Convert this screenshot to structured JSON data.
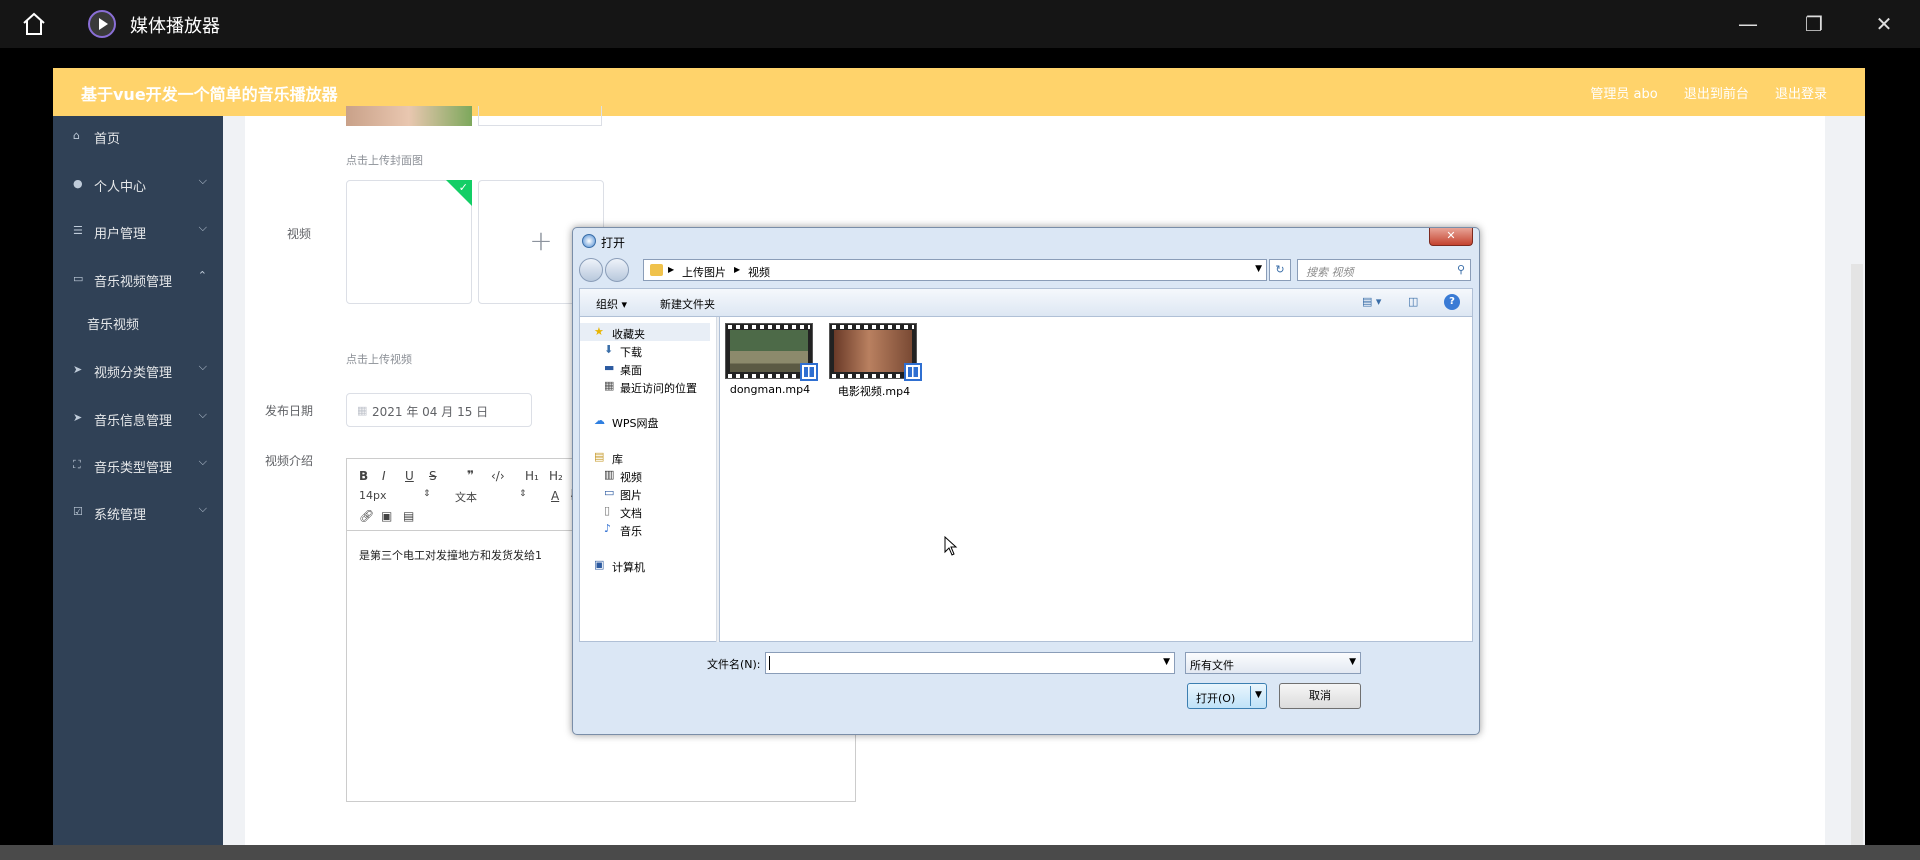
{
  "titlebar": {
    "title": "媒体播放器"
  },
  "topbar": {
    "brand": "基于vue开发一个简单的音乐播放器",
    "links": [
      "管理员 abo",
      "退出到前台",
      "退出登录"
    ]
  },
  "sidebar": {
    "items": [
      {
        "label": "首页",
        "icon": "home-icon",
        "arrow": ""
      },
      {
        "label": "个人中心",
        "icon": "user-icon",
        "arrow": "⌵"
      },
      {
        "label": "用户管理",
        "icon": "list-icon",
        "arrow": "⌵"
      },
      {
        "label": "音乐视频管理",
        "icon": "message-icon",
        "arrow": "⌃"
      },
      {
        "label": "音乐视频",
        "icon": "",
        "arrow": ""
      },
      {
        "label": "视频分类管理",
        "icon": "send-icon",
        "arrow": "⌵"
      },
      {
        "label": "音乐信息管理",
        "icon": "send-icon",
        "arrow": "⌵"
      },
      {
        "label": "音乐类型管理",
        "icon": "scan-icon",
        "arrow": "⌵"
      },
      {
        "label": "系统管理",
        "icon": "check-icon",
        "arrow": "⌵"
      }
    ]
  },
  "form": {
    "cover_hint": "点击上传封面图",
    "video_label": "视频",
    "video_hint": "点击上传视频",
    "date_label": "发布日期",
    "date_value": "2021 年 04 月 15 日",
    "intro_label": "视频介绍",
    "editor": {
      "font_size": "14px",
      "block_type": "文本",
      "text": "是第三个电工对发撞地方和发货发给1"
    }
  },
  "dialog": {
    "title": "打开",
    "breadcrumb": [
      "上传图片",
      "视频"
    ],
    "search_placeholder": "搜索 视频",
    "commands": {
      "organize": "组织 ▾",
      "new_folder": "新建文件夹"
    },
    "nav": {
      "favorites": "收藏夹",
      "fav_items": [
        "下载",
        "桌面",
        "最近访问的位置"
      ],
      "wps": "WPS网盘",
      "library": "库",
      "lib_items": [
        "视频",
        "图片",
        "文档",
        "音乐"
      ],
      "computer": "计算机"
    },
    "files": [
      {
        "name": "dongman.mp4"
      },
      {
        "name": "电影视频.mp4"
      }
    ],
    "filename_label": "文件名(N):",
    "filename_value": "",
    "filter_value": "所有文件",
    "open_label": "打开(O)",
    "cancel_label": "取消"
  }
}
